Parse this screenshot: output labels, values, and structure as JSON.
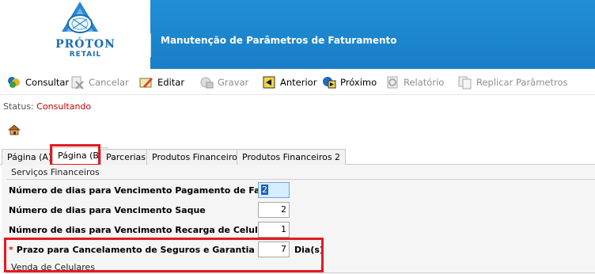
{
  "header": {
    "logo_text": "PRÓTON",
    "logo_sub": "RETAIL",
    "logo_reg": "®",
    "title": "Manutenção de Parâmetros de Faturamento",
    "bg_color": "#1a7ec5"
  },
  "toolbar": {
    "items": [
      {
        "label": "Consultar",
        "icon": "search-people-icon",
        "enabled": true
      },
      {
        "label": "Cancelar",
        "icon": "cancel-doc-icon",
        "enabled": false
      },
      {
        "label": "Editar",
        "icon": "edit-icon",
        "enabled": true
      },
      {
        "label": "Gravar",
        "icon": "save-icon",
        "enabled": false
      },
      {
        "label": "Anterior",
        "icon": "previous-icon",
        "enabled": true
      },
      {
        "label": "Próximo",
        "icon": "next-icon",
        "enabled": true
      },
      {
        "label": "Relatório",
        "icon": "report-icon",
        "enabled": false
      },
      {
        "label": "Replicar Parâmetros",
        "icon": "replicate-icon",
        "enabled": false
      }
    ]
  },
  "status": {
    "label": "Status:",
    "value": "Consultando"
  },
  "tabs": [
    {
      "label": "Página (A)",
      "active": false
    },
    {
      "label": "Página (B)",
      "active": true
    },
    {
      "label": "Parcerias",
      "active": false
    },
    {
      "label": "Produtos Financeiros",
      "active": false
    },
    {
      "label": "Produtos Financeiros 2",
      "active": false
    }
  ],
  "section": {
    "title": "Serviços Financeiros",
    "rows": [
      {
        "label": "Número de dias para Vencimento Pagamento de Fatura",
        "value": "2",
        "focused": true
      },
      {
        "label": "Número de dias para Vencimento Saque",
        "value": "2",
        "focused": false
      },
      {
        "label": "Número de dias para Vencimento Recarga de Celular",
        "value": "1",
        "focused": false
      },
      {
        "label": "Prazo para Cancelamento de Seguros e Garantia",
        "value": "7",
        "focused": false,
        "required": true,
        "required_mark": "*",
        "unit": "Dia(s)"
      }
    ]
  },
  "section2": {
    "title": "Venda de Celulares"
  },
  "colors": {
    "highlight": "#e11b22",
    "status_value": "#c00000"
  }
}
